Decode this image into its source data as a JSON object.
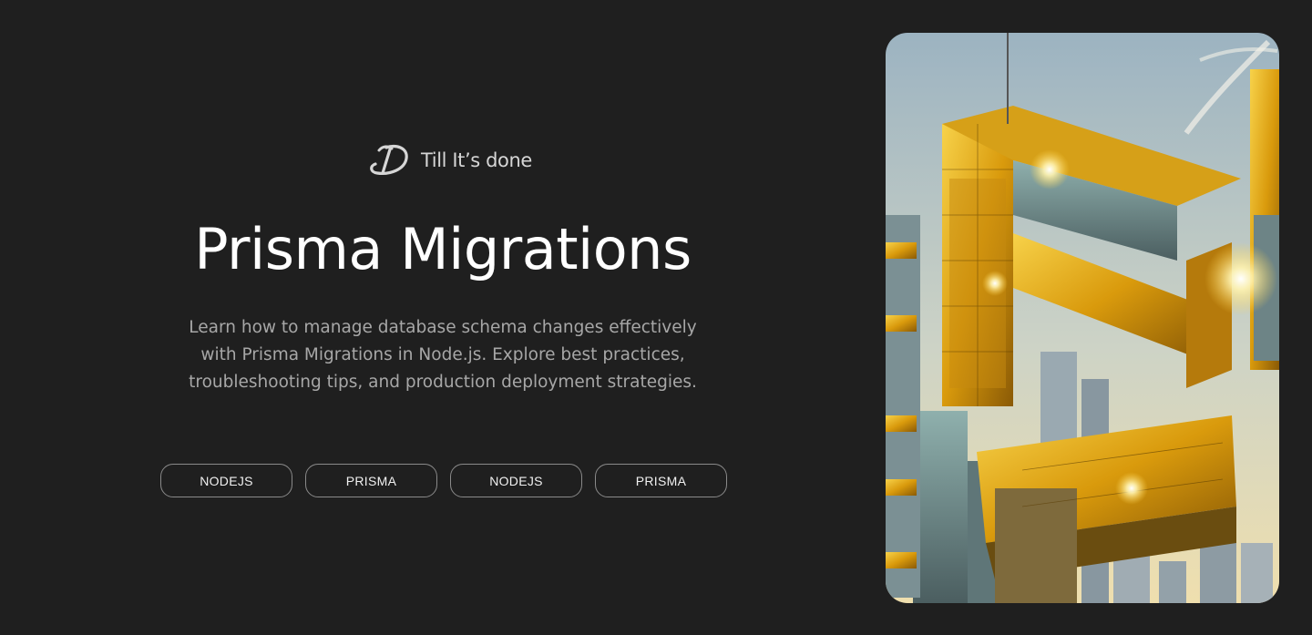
{
  "brand": {
    "name": "Till It’s done",
    "logo_icon": "script-d-logo-icon"
  },
  "hero": {
    "title": "Prisma Migrations",
    "description": "Learn how to manage database schema changes effectively with Prisma Migrations in Node.js. Explore best practices, troubleshooting tips, and production deployment strategies."
  },
  "tags": [
    {
      "label": "NODEJS"
    },
    {
      "label": "PRISMA"
    },
    {
      "label": "NODEJS"
    },
    {
      "label": "PRISMA"
    }
  ],
  "image": {
    "subject": "golden-glass-skyscraper-illustration",
    "colors": {
      "sky_top": "#9fb6c4",
      "sky_bottom": "#e9dcae",
      "gold": "#e8b318",
      "glass": "#6f8a8c"
    }
  },
  "colors": {
    "background": "#1f1f1f",
    "title": "#ffffff",
    "description": "#a7a7a7",
    "tag_border": "#8a8a8a"
  }
}
